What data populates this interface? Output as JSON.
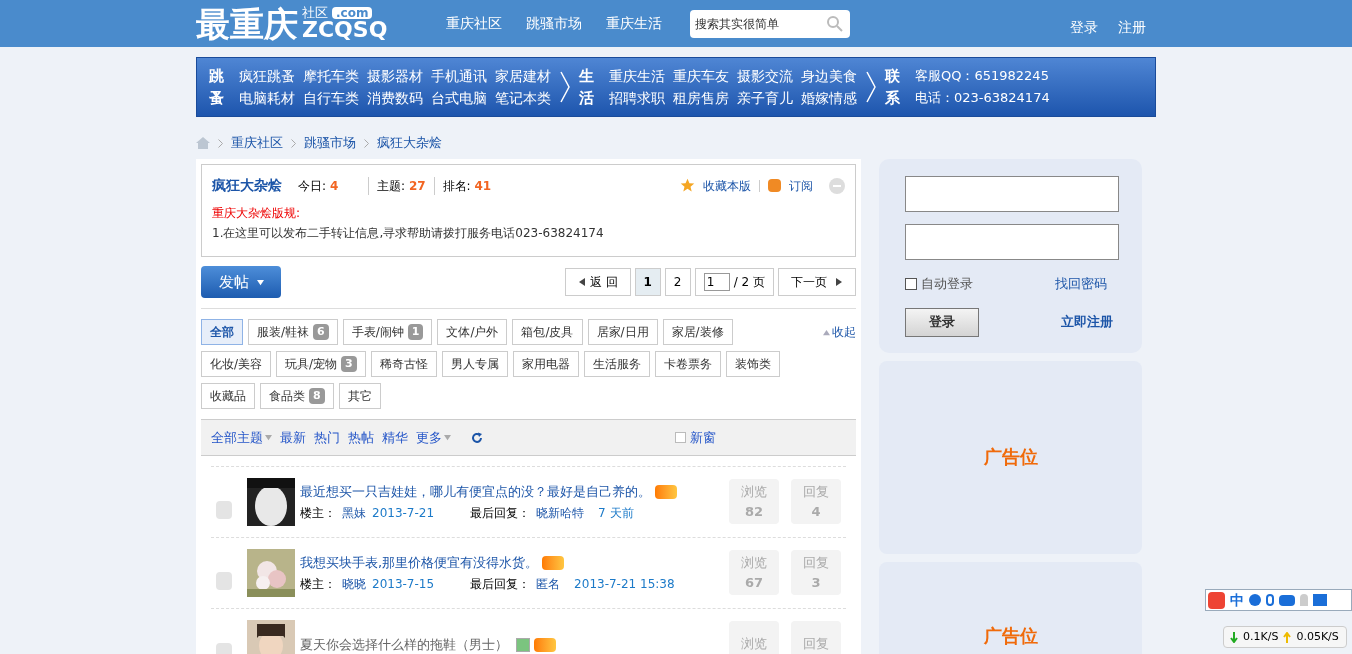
{
  "header": {
    "logo": {
      "main": "最重庆",
      "sub": "社区",
      "domain": ".com",
      "latin": "ZCQSQ"
    },
    "nav": [
      "重庆社区",
      "跳骚市场",
      "重庆生活"
    ],
    "search": {
      "placeholder": "搜索其实很简单"
    },
    "auth": [
      "登录",
      "注册"
    ]
  },
  "banner": [
    {
      "label": "跳蚤",
      "kind": "links",
      "links": [
        "疯狂跳蚤",
        "摩托车类",
        "摄影器材",
        "手机通讯",
        "家居建材",
        "电脑耗材",
        "自行车类",
        "消费数码",
        "台式电脑",
        "笔记本类"
      ]
    },
    {
      "label": "生活",
      "kind": "links",
      "links": [
        "重庆生活",
        "重庆车友",
        "摄影交流",
        "身边美食",
        "招聘求职",
        "租房售房",
        "亲子育儿",
        "婚嫁情感"
      ]
    },
    {
      "label": "联系",
      "kind": "contact",
      "links": [
        "客服QQ：651982245",
        "电话：023-63824174"
      ]
    }
  ],
  "breadcrumb": [
    "重庆社区",
    "跳骚市场",
    "疯狂大杂烩"
  ],
  "forum": {
    "name": "疯狂大杂烩",
    "stats": [
      {
        "label": "今日:",
        "value": "4"
      },
      {
        "label": "主题:",
        "value": "27"
      },
      {
        "label": "排名:",
        "value": "41"
      }
    ],
    "actions": [
      "收藏本版",
      "订阅"
    ],
    "rules_title": "重庆大杂烩版规:",
    "rules_text": "1.在这里可以发布二手转让信息,寻求帮助请拨打服务电话023-63824174"
  },
  "post_button": "发帖",
  "pagination": {
    "back": "返 回",
    "pages": [
      {
        "label": "1",
        "selected": true
      },
      {
        "label": "2",
        "selected": false
      }
    ],
    "page_input": "1",
    "total": "/ 2 页",
    "next": "下一页"
  },
  "categories": [
    {
      "label": "全部",
      "selected": true
    },
    {
      "label": "服装/鞋袜",
      "count": "6",
      "selected": false
    },
    {
      "label": "手表/闹钟",
      "count": "1",
      "selected": false
    },
    {
      "label": "文体/户外",
      "selected": false
    },
    {
      "label": "箱包/皮具",
      "selected": false
    },
    {
      "label": "居家/日用",
      "selected": false
    },
    {
      "label": "家居/装修",
      "selected": false
    },
    {
      "label": "化妆/美容",
      "selected": false
    },
    {
      "label": "玩具/宠物",
      "count": "3",
      "selected": false
    },
    {
      "label": "稀奇古怪",
      "selected": false
    },
    {
      "label": "男人专属",
      "selected": false
    },
    {
      "label": "家用电器",
      "selected": false
    },
    {
      "label": "生活服务",
      "selected": false
    },
    {
      "label": "卡卷票务",
      "selected": false
    },
    {
      "label": "装饰类",
      "selected": false
    },
    {
      "label": "收藏品",
      "selected": false
    },
    {
      "label": "食品类",
      "count": "8",
      "selected": false
    },
    {
      "label": "其它",
      "selected": false
    }
  ],
  "collapse": "收起",
  "filters": [
    {
      "label": "全部主题",
      "dropdown": true
    },
    {
      "label": "最新",
      "dropdown": false
    },
    {
      "label": "热门",
      "dropdown": false
    },
    {
      "label": "热帖",
      "dropdown": false
    },
    {
      "label": "精华",
      "dropdown": false
    },
    {
      "label": "更多",
      "dropdown": true
    }
  ],
  "new_window": {
    "label": "新窗",
    "checked": false
  },
  "threads": [
    {
      "title": "最近想买一只吉娃娃，哪儿有便宜点的没？最好是自己养的。",
      "visited": false,
      "has_image": false,
      "hot": true,
      "author_label": "楼主：",
      "author": "黑妹",
      "date": "2013-7-21",
      "last_label": "最后回复：",
      "last_user": "晓新哈特",
      "last_time": "7 天前",
      "views_label": "浏览",
      "views": "82",
      "replies_label": "回复",
      "replies": "4"
    },
    {
      "title": "我想买块手表,那里价格便宜有没得水货。",
      "visited": false,
      "has_image": false,
      "hot": true,
      "author_label": "楼主：",
      "author": "晓晓",
      "date": "2013-7-15",
      "last_label": "最后回复：",
      "last_user": "匿名",
      "last_time": "2013-7-21 15:38",
      "views_label": "浏览",
      "views": "67",
      "replies_label": "回复",
      "replies": "3"
    },
    {
      "title": "夏天你会选择什么样的拖鞋（男士）",
      "visited": true,
      "has_image": true,
      "hot": true,
      "views_label": "浏览",
      "replies_label": "回复"
    }
  ],
  "login": {
    "auto_login": {
      "label": "自动登录",
      "checked": false
    },
    "forgot": "找回密码",
    "button": "登录",
    "register": "立即注册"
  },
  "ads": [
    "广告位",
    "广告位"
  ],
  "ime": {
    "label": "中"
  },
  "net": {
    "down": "0.1K/S",
    "up": "0.05K/S"
  }
}
